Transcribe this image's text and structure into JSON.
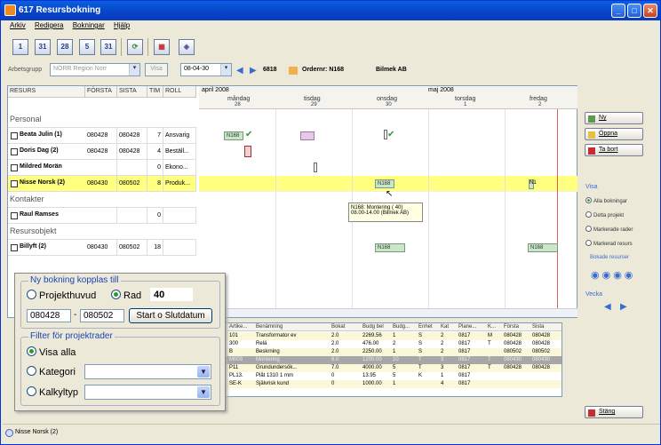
{
  "window": {
    "title": "617 Resursbokning"
  },
  "menu": [
    "Arkiv",
    "Redigera",
    "Bokningar",
    "Hjälp"
  ],
  "toolbar": {
    "btn1": "1",
    "btn2": "31",
    "btn3": "28",
    "btn4": "5",
    "btn5": "31"
  },
  "filter": {
    "arbetsgrupp_label": "Arbetsgrupp",
    "arbetsgrupp_value": "NORR Region Norr",
    "visa_label": "Visa",
    "date_value": "08-04-30",
    "order_code": "6818",
    "order_label": "Ordernr: N168",
    "customer": "Bilmek AB"
  },
  "grid": {
    "headers": [
      "RESURS",
      "FÖRSTA",
      "SISTA",
      "TIM",
      "ROLL"
    ],
    "groups": {
      "personal": "Personal",
      "kontakter": "Kontakter",
      "resursobjekt": "Resursobjekt"
    },
    "rows": [
      {
        "name": "Beata Julin (1)",
        "forsta": "080428",
        "sista": "080428",
        "tim": "7",
        "roll": "Ansvarig"
      },
      {
        "name": "Doris Dag (2)",
        "forsta": "080428",
        "sista": "080428",
        "tim": "4",
        "roll": "Beställ..."
      },
      {
        "name": "Mildred Morän",
        "forsta": "",
        "sista": "",
        "tim": "0",
        "roll": "Ekono..."
      },
      {
        "name": "Nisse Norsk (2)",
        "forsta": "080430",
        "sista": "080502",
        "tim": "8",
        "roll": "Produk..."
      },
      {
        "name": "Raul Ramses",
        "forsta": "",
        "sista": "",
        "tim": "0",
        "roll": ""
      },
      {
        "name": "Billyft (2)",
        "forsta": "080430",
        "sista": "080502",
        "tim": "18",
        "roll": ""
      }
    ]
  },
  "timeline": {
    "month1": "april 2008",
    "month2": "maj 2008",
    "days": [
      {
        "d": "måndag",
        "n": "28"
      },
      {
        "d": "tisdag",
        "n": "29"
      },
      {
        "d": "onsdag",
        "n": "30"
      },
      {
        "d": "torsdag",
        "n": "1"
      },
      {
        "d": "fredag",
        "n": "2"
      }
    ],
    "bars": {
      "b1": "N168",
      "b2": "N168",
      "b3": "N168",
      "b4": "N168",
      "b5": "N1"
    },
    "tooltip_line1": "N168: Montering (   40)",
    "tooltip_line2": "08.00-14.00 (Bilmek AB)"
  },
  "right": {
    "ny": "Ny",
    "oppna": "Öppna",
    "tabort": "Ta bort",
    "visa": "Visa",
    "opt1": "Alla bokningar",
    "opt2": "Detta projekt",
    "opt3": "Markerade rader",
    "opt4": "Markerad resurs",
    "bokade": "Bokade resurser",
    "vecka": "Vecka",
    "stang": "Stäng"
  },
  "dialog": {
    "title": "Ny bokning kopplas till",
    "projekthuvud": "Projekthuvud",
    "rad": "Rad",
    "rad_value": "40",
    "start": "080428",
    "dash": "-",
    "end": "080502",
    "btn": "Start o Slutdatum",
    "filter_title": "Filter för projektrader",
    "visa_alla": "Visa alla",
    "kategori": "Kategori",
    "kalkyltyp": "Kalkyltyp"
  },
  "btable": {
    "headers": [
      "Artike...",
      "Benämning",
      "Bokat",
      "Budg bel",
      "Budg...",
      "Enhet",
      "Kat",
      "Plane...",
      "K...",
      "Första",
      "Sista"
    ],
    "rows": [
      [
        "101",
        "Transformator ev",
        "2.0",
        "2269.56",
        "1",
        "S",
        "2",
        "0817",
        "M",
        "080428",
        "080428"
      ],
      [
        "300",
        "Relä",
        "2.0",
        "476.00",
        "2",
        "S",
        "2",
        "0817",
        "T",
        "080428",
        "080428"
      ],
      [
        "B",
        "Beskrning",
        "2.0",
        "2250.00",
        "1",
        "S",
        "2",
        "0817",
        "",
        "080502",
        "080502"
      ],
      [
        "M003",
        "Montering",
        "6.0",
        "1200.00",
        "10",
        "T",
        "3",
        "0817",
        "T",
        "080430",
        "080430"
      ],
      [
        "P11",
        "Grundundersök...",
        "7.0",
        "4000.00",
        "5",
        "T",
        "3",
        "0817",
        "T",
        "080428",
        "080428"
      ],
      [
        "PL13.",
        "Plåt 1310 1 mm",
        "0",
        "13.95",
        "5",
        "K",
        "1",
        "0817",
        "",
        "",
        ""
      ],
      [
        "SE-K",
        "Självrisk kund",
        "0",
        "1000.00",
        "1",
        "",
        "4",
        "0817",
        "",
        "",
        ""
      ]
    ]
  },
  "status": "Nisse Norsk (2)"
}
